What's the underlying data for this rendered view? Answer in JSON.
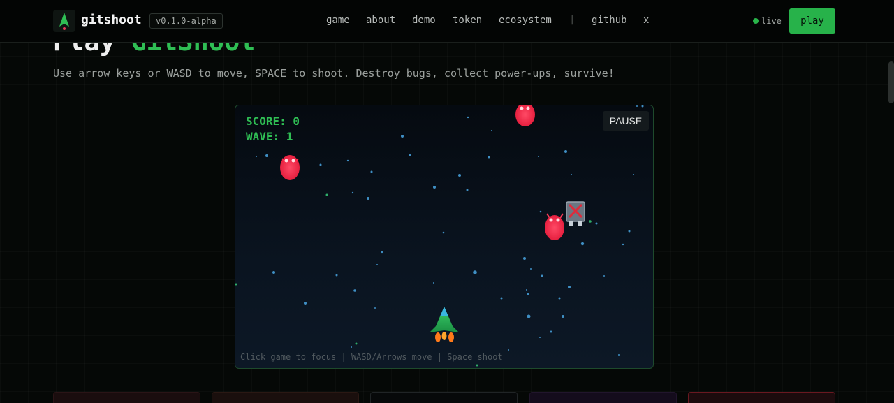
{
  "navbar": {
    "brand": "gitshoot",
    "version": "v0.1.0-alpha",
    "links": [
      "game",
      "about",
      "demo",
      "token",
      "ecosystem"
    ],
    "separator": "|",
    "external_links": [
      "github",
      "x"
    ],
    "status": "live",
    "play_label": "play"
  },
  "hero": {
    "title_prefix": "Play ",
    "title_accent": "GitShoot",
    "instructions": "Use arrow keys or WASD to move, SPACE to shoot. Destroy bugs, collect power-ups, survive!"
  },
  "game": {
    "score_label": "SCORE: 0",
    "wave_label": "WAVE: 1",
    "pause_label": "PAUSE",
    "hint": "Click game to focus | WASD/Arrows move | Space shoot"
  },
  "colors": {
    "accent": "#2fbe54",
    "bug": "#ff3c5a",
    "background": "#050806"
  }
}
